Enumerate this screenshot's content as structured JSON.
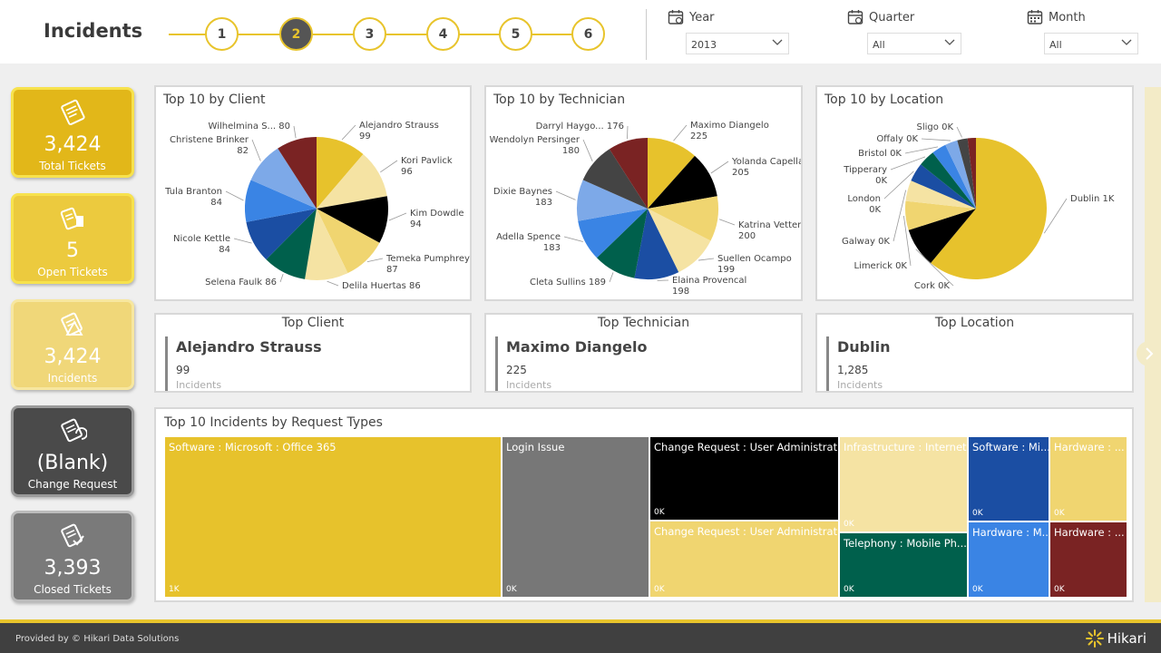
{
  "header": {
    "title": "Incidents",
    "steps": [
      "1",
      "2",
      "3",
      "4",
      "5",
      "6"
    ],
    "active_step": 2,
    "filters": {
      "year": {
        "label": "Year",
        "value": "2013"
      },
      "quarter": {
        "label": "Quarter",
        "value": "All"
      },
      "month": {
        "label": "Month",
        "value": "All"
      }
    }
  },
  "cards": [
    {
      "value": "3,424",
      "label": "Total Tickets",
      "color": "#e2b719",
      "icon": "ticket-icon"
    },
    {
      "value": "5",
      "label": "Open Tickets",
      "color": "#ecca3e",
      "icon": "open-ticket-icon"
    },
    {
      "value": "3,424",
      "label": "Incidents",
      "color": "#f0d779",
      "icon": "incident-icon"
    },
    {
      "value": "(Blank)",
      "label": "Change Request",
      "color": "#4a4a4a",
      "icon": "change-request-icon"
    },
    {
      "value": "3,393",
      "label": "Closed Tickets",
      "color": "#7a7a7a",
      "icon": "closed-ticket-icon"
    }
  ],
  "charts": {
    "client": {
      "title": "Top 10 by Client"
    },
    "technician": {
      "title": "Top 10 by Technician"
    },
    "location": {
      "title": "Top 10 by Location"
    }
  },
  "top": {
    "client": {
      "heading": "Top Client",
      "name": "Alejandro Strauss",
      "value": "99",
      "sub": "Incidents"
    },
    "technician": {
      "heading": "Top Technician",
      "name": "Maximo Diangelo",
      "value": "225",
      "sub": "Incidents"
    },
    "location": {
      "heading": "Top Location",
      "name": "Dublin",
      "value": "1,285",
      "sub": "Incidents"
    }
  },
  "treemap": {
    "title": "Top 10 Incidents by Request Types",
    "tiles": [
      {
        "label": "Software : Microsoft : Office 365",
        "value": "1K",
        "color": "#e7c22c",
        "text": "#fff"
      },
      {
        "label": "Login Issue",
        "value": "0K",
        "color": "#777777",
        "text": "#fff"
      },
      {
        "label": "Change Request : User Administrati...",
        "value": "0K",
        "color": "#000000",
        "text": "#fff"
      },
      {
        "label": "Infrastructure : Internet...",
        "value": "0K",
        "color": "#f5e3a3",
        "text": "#fff"
      },
      {
        "label": "Software : Mi...",
        "value": "0K",
        "color": "#1b4ea3",
        "text": "#fff"
      },
      {
        "label": "Hardware : ...",
        "value": "0K",
        "color": "#f0d570",
        "text": "#fff"
      },
      {
        "label": "Change Request : User Administrati...",
        "value": "0K",
        "color": "#f0d570",
        "text": "#fff"
      },
      {
        "label": "Telephony : Mobile Ph...",
        "value": "0K",
        "color": "#00604c",
        "text": "#fff"
      },
      {
        "label": "Hardware : M...",
        "value": "0K",
        "color": "#3a84e4",
        "text": "#fff"
      },
      {
        "label": "Hardware : ...",
        "value": "0K",
        "color": "#7a2323",
        "text": "#fff"
      }
    ]
  },
  "footer": {
    "text": "Provided by © Hikari Data Solutions",
    "brand": "Hikari"
  },
  "chart_data": [
    {
      "type": "pie",
      "title": "Top 10 by Client",
      "categories": [
        "Alejandro Strauss",
        "Kori Pavlick",
        "Kim Dowdle",
        "Temeka Pumphrey",
        "Delila Huertas",
        "Selena Faulk",
        "Nicole Kettle",
        "Tula Branton",
        "Christene Brinker",
        "Wilhelmina S..."
      ],
      "values": [
        99,
        96,
        94,
        87,
        86,
        86,
        84,
        84,
        82,
        80
      ],
      "labels": [
        "Alejandro Strauss|99",
        "Kori Pavlick|96",
        "Kim Dowdle|94",
        "Temeka Pumphrey|87",
        "Delila Huertas 86",
        "Selena Faulk 86",
        "Nicole Kettle|84",
        "Tula Branton|84",
        "Christene Brinker|82",
        "Wilhelmina S... 80"
      ],
      "colors": [
        "#e7c22c",
        "#f5e3a3",
        "#000000",
        "#f0d570",
        "#f5e3a3",
        "#00604c",
        "#1b4ea3",
        "#3a84e4",
        "#7da9e8",
        "#7a2323"
      ]
    },
    {
      "type": "pie",
      "title": "Top 10 by Technician",
      "categories": [
        "Maximo Diangelo",
        "Yolanda Capella",
        "Katrina Vetter",
        "Suellen Ocampo",
        "Elaina Provencal",
        "Cleta Sullins",
        "Adella Spence",
        "Dixie Baynes",
        "Wendolyn Persinger",
        "Darryl Haygo..."
      ],
      "values": [
        225,
        205,
        200,
        199,
        198,
        189,
        183,
        183,
        180,
        176
      ],
      "labels": [
        "Maximo Diangelo|225",
        "Yolanda Capella|205",
        "Katrina Vetter|200",
        "Suellen Ocampo|199",
        "Elaina Provencal|198",
        "Cleta Sullins 189",
        "Adella Spence|183",
        "Dixie Baynes|183",
        "Wendolyn Persinger|180",
        "Darryl Haygo... 176"
      ],
      "colors": [
        "#e7c22c",
        "#000000",
        "#f0d570",
        "#f5e3a3",
        "#1b4ea3",
        "#00604c",
        "#3a84e4",
        "#7da9e8",
        "#444444",
        "#7a2323"
      ]
    },
    {
      "type": "pie",
      "title": "Top 10 by Location",
      "categories": [
        "Dublin",
        "Cork",
        "Limerick",
        "Galway",
        "London",
        "Tipperary",
        "Bristol",
        "Offaly",
        "Sligo",
        ""
      ],
      "values": [
        1285,
        190,
        140,
        100,
        90,
        80,
        70,
        60,
        50,
        40
      ],
      "labels": [
        "Dublin 1K",
        "Cork 0K",
        "Limerick 0K",
        "Galway 0K",
        "London|0K",
        "Tipperary|0K",
        "Bristol 0K",
        "Offaly 0K",
        "Sligo 0K",
        ""
      ],
      "colors": [
        "#e7c22c",
        "#000000",
        "#f0d570",
        "#f5e3a3",
        "#1b4ea3",
        "#00604c",
        "#3a84e4",
        "#7da9e8",
        "#444444",
        "#7a2323"
      ]
    }
  ]
}
